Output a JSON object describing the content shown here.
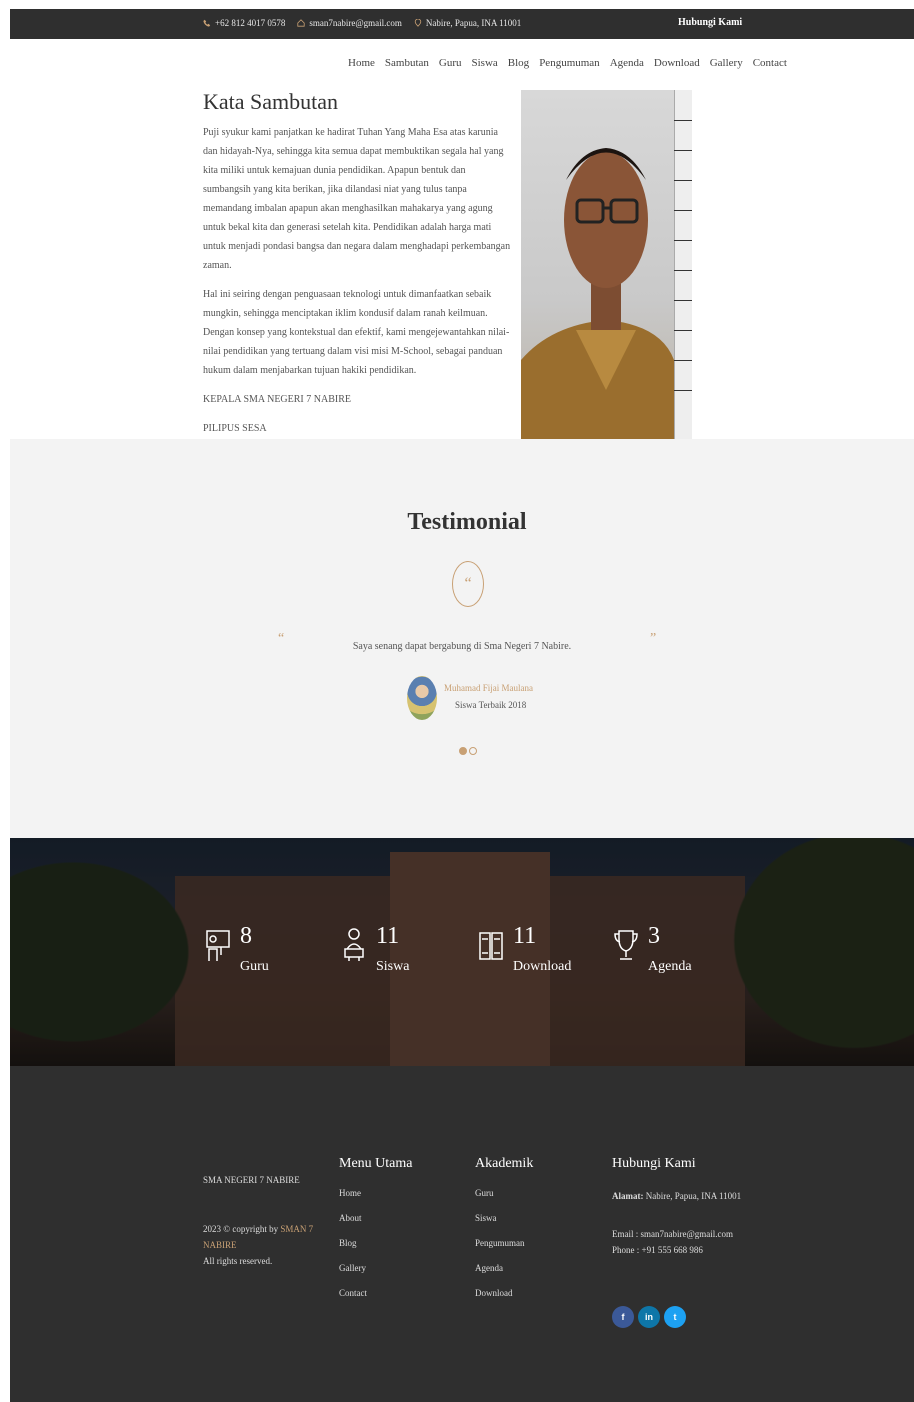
{
  "topbar": {
    "phone": "+62 812 4017 0578",
    "email": "sman7nabire@gmail.com",
    "address": "Nabire, Papua, INA 11001",
    "cta": "Hubungi Kami"
  },
  "nav": {
    "items": [
      "Home",
      "Sambutan",
      "Guru",
      "Siswa",
      "Blog",
      "Pengumuman",
      "Agenda",
      "Download",
      "Gallery",
      "Contact"
    ]
  },
  "welcome": {
    "title": "Kata Sambutan",
    "p1": "Puji syukur kami panjatkan ke hadirat Tuhan Yang Maha Esa atas karunia dan hidayah-Nya, sehingga kita semua dapat membuktikan segala hal yang kita miliki untuk kemajuan dunia pendidikan. Apapun bentuk dan sumbangsih yang kita berikan, jika dilandasi niat yang tulus tanpa memandang imbalan apapun akan menghasilkan mahakarya yang agung untuk bekal kita dan generasi setelah kita. Pendidikan adalah harga mati untuk menjadi pondasi bangsa dan negara dalam menghadapi perkembangan zaman.",
    "p2": "Hal ini seiring dengan penguasaan teknologi untuk dimanfaatkan sebaik mungkin, sehingga menciptakan iklim kondusif dalam ranah keilmuan. Dengan konsep yang kontekstual dan efektif, kami mengejewantahkan nilai-nilai pendidikan yang tertuang dalam visi misi M-School, sebagai panduan hukum dalam menjabarkan tujuan hakiki pendidikan.",
    "signature_title": "KEPALA SMA NEGERI 7 NABIRE",
    "signature_name": "PILIPUS SESA"
  },
  "testimonial": {
    "title": "Testimonial",
    "quote": "Saya senang dapat bergabung di Sma Negeri 7 Nabire.",
    "author": "Muhamad Fijai Maulana",
    "role": "Siswa Terbaik 2018"
  },
  "stats": [
    {
      "value": "8",
      "label": "Guru"
    },
    {
      "value": "11",
      "label": "Siswa"
    },
    {
      "value": "11",
      "label": "Download"
    },
    {
      "value": "3",
      "label": "Agenda"
    }
  ],
  "footer": {
    "brand": "SMA NEGERI 7 NABIRE",
    "copy_prefix": "2023 © copyright by",
    "copy_brand": "SMAN 7 NABIRE",
    "copy_suffix": "All rights reserved.",
    "menu_title": "Menu Utama",
    "menu_items": [
      "Home",
      "About",
      "Blog",
      "Gallery",
      "Contact"
    ],
    "akademik_title": "Akademik",
    "akademik_items": [
      "Guru",
      "Siswa",
      "Pengumuman",
      "Agenda",
      "Download"
    ],
    "contact_title": "Hubungi Kami",
    "address_label": "Alamat:",
    "address": "Nabire, Papua, INA 11001",
    "email": "Email : sman7nabire@gmail.com",
    "phone": "Phone : +91 555 668 986",
    "social": [
      "f",
      "in",
      "t"
    ]
  },
  "colors": {
    "accent": "#c8a074",
    "dark": "#2f2f2f",
    "facebook": "#3b5998",
    "linkedin": "#0e76a8",
    "twitter": "#1da1f2"
  }
}
